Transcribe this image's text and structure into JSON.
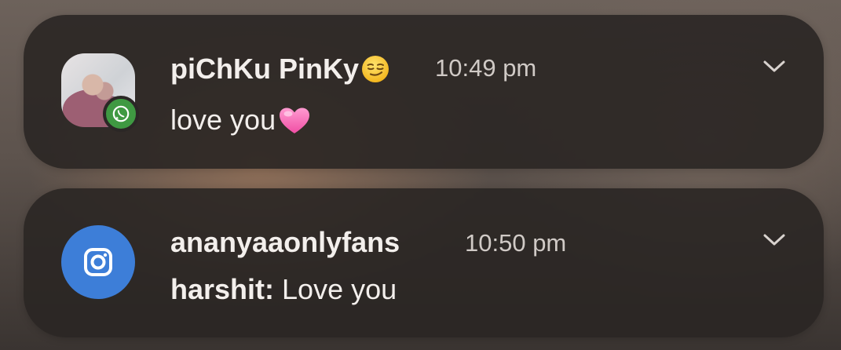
{
  "notifications": [
    {
      "app": "whatsapp",
      "app_icon": "whatsapp-icon",
      "title": "piChKu PinKy",
      "title_emoji": "smirking-face-emoji",
      "time": "10:49 pm",
      "message": "love you",
      "message_emoji": "pink-heart-emoji",
      "badge_color": "#3f9942"
    },
    {
      "app": "instagram",
      "app_icon": "instagram-icon",
      "title": "ananyaaonlyfans",
      "time": "10:50 pm",
      "sender": "harshit:",
      "message": "Love you",
      "avatar_color": "#3d7ed8"
    }
  ],
  "colors": {
    "card_background": "#2a2624",
    "text_primary": "#f3efec",
    "text_secondary": "#d0cac6"
  },
  "icons": {
    "expand": "chevron-down-icon"
  }
}
